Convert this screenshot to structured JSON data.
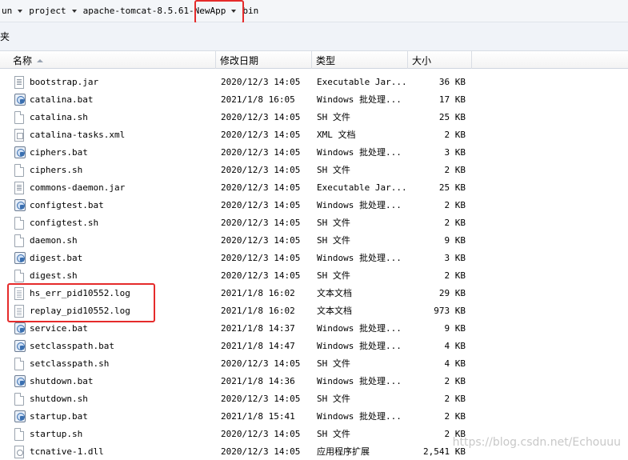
{
  "breadcrumb": {
    "items": [
      "un",
      "project",
      "apache-tomcat-8.5.61-NewApp",
      "bin"
    ]
  },
  "toolbar": {
    "label": "夹"
  },
  "columns": {
    "name": "名称",
    "date": "修改日期",
    "type": "类型",
    "size": "大小"
  },
  "files": [
    {
      "name": "bootstrap.jar",
      "date": "2020/12/3 14:05",
      "type": "Executable Jar...",
      "size": "36 KB",
      "icon": "jar"
    },
    {
      "name": "catalina.bat",
      "date": "2021/1/8 16:05",
      "type": "Windows 批处理...",
      "size": "17 KB",
      "icon": "bat"
    },
    {
      "name": "catalina.sh",
      "date": "2020/12/3 14:05",
      "type": "SH 文件",
      "size": "25 KB",
      "icon": "doc"
    },
    {
      "name": "catalina-tasks.xml",
      "date": "2020/12/3 14:05",
      "type": "XML 文档",
      "size": "2 KB",
      "icon": "xml"
    },
    {
      "name": "ciphers.bat",
      "date": "2020/12/3 14:05",
      "type": "Windows 批处理...",
      "size": "3 KB",
      "icon": "bat"
    },
    {
      "name": "ciphers.sh",
      "date": "2020/12/3 14:05",
      "type": "SH 文件",
      "size": "2 KB",
      "icon": "doc"
    },
    {
      "name": "commons-daemon.jar",
      "date": "2020/12/3 14:05",
      "type": "Executable Jar...",
      "size": "25 KB",
      "icon": "jar"
    },
    {
      "name": "configtest.bat",
      "date": "2020/12/3 14:05",
      "type": "Windows 批处理...",
      "size": "2 KB",
      "icon": "bat"
    },
    {
      "name": "configtest.sh",
      "date": "2020/12/3 14:05",
      "type": "SH 文件",
      "size": "2 KB",
      "icon": "doc"
    },
    {
      "name": "daemon.sh",
      "date": "2020/12/3 14:05",
      "type": "SH 文件",
      "size": "9 KB",
      "icon": "doc"
    },
    {
      "name": "digest.bat",
      "date": "2020/12/3 14:05",
      "type": "Windows 批处理...",
      "size": "3 KB",
      "icon": "bat"
    },
    {
      "name": "digest.sh",
      "date": "2020/12/3 14:05",
      "type": "SH 文件",
      "size": "2 KB",
      "icon": "doc"
    },
    {
      "name": "hs_err_pid10552.log",
      "date": "2021/1/8 16:02",
      "type": "文本文档",
      "size": "29 KB",
      "icon": "log"
    },
    {
      "name": "replay_pid10552.log",
      "date": "2021/1/8 16:02",
      "type": "文本文档",
      "size": "973 KB",
      "icon": "log"
    },
    {
      "name": "service.bat",
      "date": "2021/1/8 14:37",
      "type": "Windows 批处理...",
      "size": "9 KB",
      "icon": "bat"
    },
    {
      "name": "setclasspath.bat",
      "date": "2021/1/8 14:47",
      "type": "Windows 批处理...",
      "size": "4 KB",
      "icon": "bat"
    },
    {
      "name": "setclasspath.sh",
      "date": "2020/12/3 14:05",
      "type": "SH 文件",
      "size": "4 KB",
      "icon": "doc"
    },
    {
      "name": "shutdown.bat",
      "date": "2021/1/8 14:36",
      "type": "Windows 批处理...",
      "size": "2 KB",
      "icon": "bat"
    },
    {
      "name": "shutdown.sh",
      "date": "2020/12/3 14:05",
      "type": "SH 文件",
      "size": "2 KB",
      "icon": "doc"
    },
    {
      "name": "startup.bat",
      "date": "2021/1/8 15:41",
      "type": "Windows 批处理...",
      "size": "2 KB",
      "icon": "bat"
    },
    {
      "name": "startup.sh",
      "date": "2020/12/3 14:05",
      "type": "SH 文件",
      "size": "2 KB",
      "icon": "doc"
    },
    {
      "name": "tcnative-1.dll",
      "date": "2020/12/3 14:05",
      "type": "应用程序扩展",
      "size": "2,541 KB",
      "icon": "dll"
    }
  ],
  "watermark": "https://blog.csdn.net/Echouuu",
  "colors": {
    "annotation": "#e52b2b"
  }
}
